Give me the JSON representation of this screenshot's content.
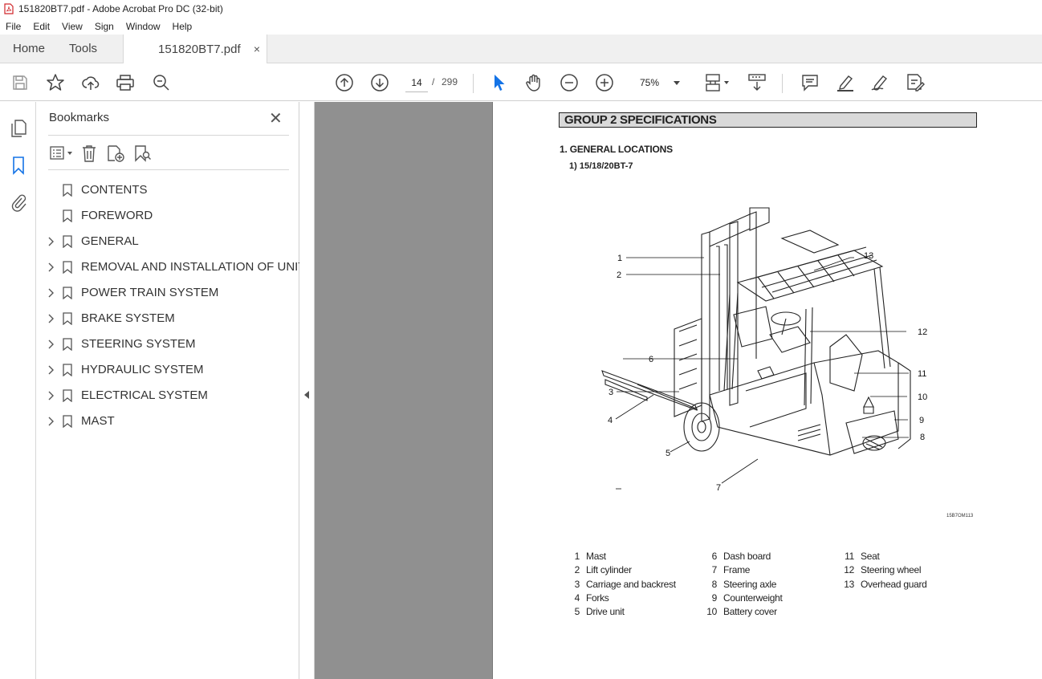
{
  "window": {
    "title": "151820BT7.pdf - Adobe Acrobat Pro DC (32-bit)"
  },
  "menu": [
    "File",
    "Edit",
    "View",
    "Sign",
    "Window",
    "Help"
  ],
  "tabs": {
    "home": "Home",
    "tools": "Tools",
    "document": "151820BT7.pdf",
    "close": "×"
  },
  "toolbar": {
    "page_current": "14",
    "page_separator": "/",
    "page_total": "299",
    "zoom": "75%",
    "icons": [
      "save-icon",
      "star-icon",
      "upload-icon",
      "print-icon",
      "zoom-search-icon",
      "page-up-icon",
      "page-down-icon",
      "select-arrow-icon",
      "hand-icon",
      "zoom-out-icon",
      "zoom-in-icon",
      "page-layout-icon",
      "scroll-mode-icon",
      "comment-icon",
      "highlight-icon",
      "sign-icon",
      "redact-icon"
    ]
  },
  "sidebar": {
    "title": "Bookmarks",
    "close": "✕",
    "bookmarks": [
      {
        "label": "CONTENTS",
        "expandable": false
      },
      {
        "label": "FOREWORD",
        "expandable": false
      },
      {
        "label": "GENERAL",
        "expandable": true
      },
      {
        "label": "REMOVAL AND INSTALLATION OF UNIT",
        "expandable": true
      },
      {
        "label": "POWER TRAIN SYSTEM",
        "expandable": true
      },
      {
        "label": "BRAKE SYSTEM",
        "expandable": true
      },
      {
        "label": "STEERING SYSTEM",
        "expandable": true
      },
      {
        "label": "HYDRAULIC SYSTEM",
        "expandable": true
      },
      {
        "label": "ELECTRICAL SYSTEM",
        "expandable": true
      },
      {
        "label": "MAST",
        "expandable": true
      }
    ]
  },
  "document": {
    "group_header": "GROUP 2  SPECIFICATIONS",
    "section": "1. GENERAL LOCATIONS",
    "subsection": "1) 15/18/20BT-7",
    "figure_code": "15B7OM113",
    "callouts": [
      "1",
      "2",
      "3",
      "4",
      "5",
      "6",
      "7",
      "8",
      "9",
      "10",
      "11",
      "12",
      "13"
    ],
    "legend": {
      "col1": [
        {
          "n": "1",
          "t": "Mast"
        },
        {
          "n": "2",
          "t": "Lift cylinder"
        },
        {
          "n": "3",
          "t": "Carriage and backrest"
        },
        {
          "n": "4",
          "t": "Forks"
        },
        {
          "n": "5",
          "t": "Drive unit"
        }
      ],
      "col2": [
        {
          "n": "6",
          "t": "Dash board"
        },
        {
          "n": "7",
          "t": "Frame"
        },
        {
          "n": "8",
          "t": "Steering axle"
        },
        {
          "n": "9",
          "t": "Counterweight"
        },
        {
          "n": "10",
          "t": "Battery cover"
        }
      ],
      "col3": [
        {
          "n": "11",
          "t": "Seat"
        },
        {
          "n": "12",
          "t": "Steering wheel"
        },
        {
          "n": "13",
          "t": "Overhead guard"
        }
      ]
    }
  }
}
